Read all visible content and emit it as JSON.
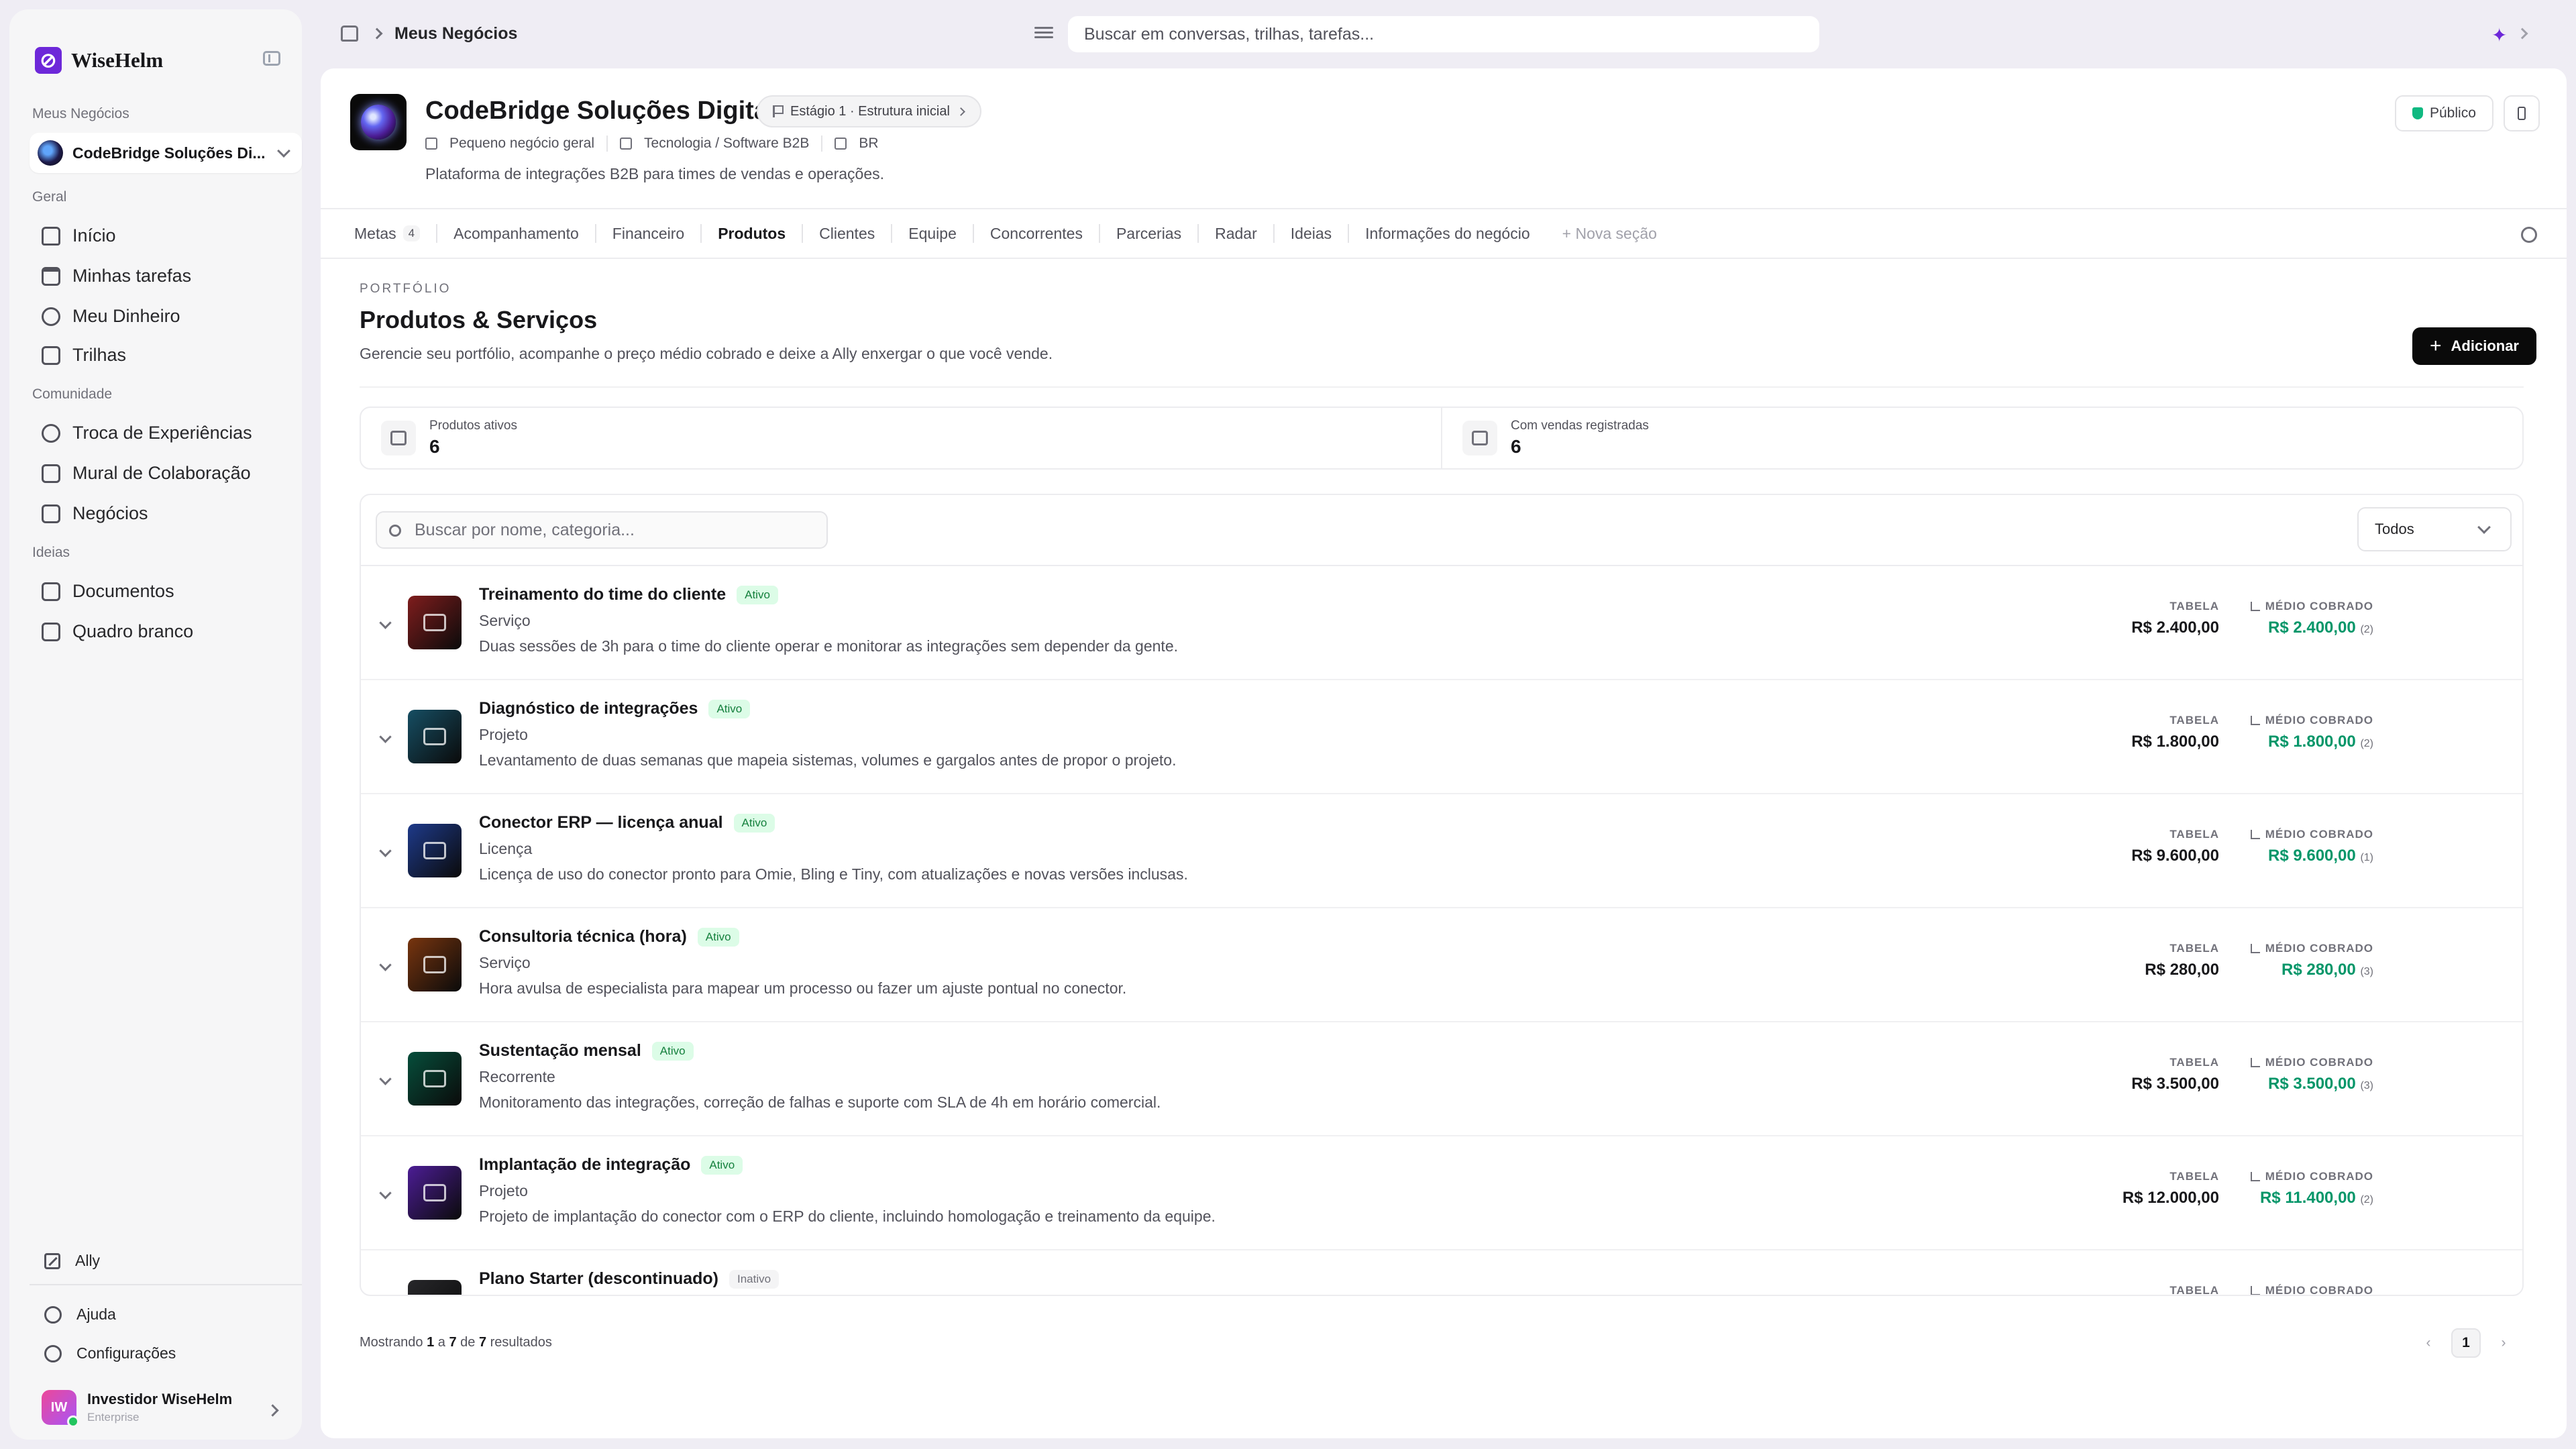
{
  "sidebar": {
    "brand": "WiseHelm",
    "sections": {
      "businesses": "Meus Negócios",
      "general": "Geral",
      "community": "Comunidade",
      "ideas": "Ideias"
    },
    "business_select": "CodeBridge Soluções Di...",
    "general_items": [
      {
        "label": "Início",
        "icon": "home-icon"
      },
      {
        "label": "Minhas tarefas",
        "icon": "calendar-icon"
      },
      {
        "label": "Meu Dinheiro",
        "icon": "piggy-bank-icon"
      },
      {
        "label": "Trilhas",
        "icon": "book-icon"
      }
    ],
    "community_items": [
      {
        "label": "Troca de Experiências",
        "icon": "chat-icon"
      },
      {
        "label": "Mural de Colaboração",
        "icon": "message-icon"
      },
      {
        "label": "Negócios",
        "icon": "building-icon"
      }
    ],
    "idea_items": [
      {
        "label": "Documentos",
        "icon": "document-icon"
      },
      {
        "label": "Quadro branco",
        "icon": "whiteboard-icon"
      }
    ],
    "footer": {
      "ally": "Ally",
      "help": "Ajuda",
      "settings": "Configurações"
    },
    "user": {
      "initials": "IW",
      "name": "Investidor WiseHelm",
      "plan": "Enterprise"
    }
  },
  "topbar": {
    "breadcrumb": "Meus Negócios",
    "search_placeholder": "Buscar em conversas, trilhas, tarefas..."
  },
  "business": {
    "name": "CodeBridge Soluções Digitais",
    "stage": "Estágio 1 · Estrutura inicial",
    "meta": [
      "Pequeno negócio geral",
      "Tecnologia / Software B2B",
      "BR"
    ],
    "description": "Plataforma de integrações B2B para times de vendas e operações.",
    "visibility": "Público"
  },
  "tabs": [
    {
      "label": "Metas",
      "badge": "4"
    },
    {
      "label": "Acompanhamento"
    },
    {
      "label": "Financeiro"
    },
    {
      "label": "Produtos",
      "active": true
    },
    {
      "label": "Clientes"
    },
    {
      "label": "Equipe"
    },
    {
      "label": "Concorrentes"
    },
    {
      "label": "Parcerias"
    },
    {
      "label": "Radar"
    },
    {
      "label": "Ideias"
    },
    {
      "label": "Informações do negócio"
    }
  ],
  "new_section": "+ Nova seção",
  "portfolio": {
    "eyebrow": "PORTFÓLIO",
    "title": "Produtos & Serviços",
    "description": "Gerencie seu portfólio, acompanhe o preço médio cobrado e deixe a Ally enxergar o que você vende.",
    "add_label": "Adicionar"
  },
  "stats": [
    {
      "label": "Produtos ativos",
      "value": "6"
    },
    {
      "label": "Com vendas registradas",
      "value": "6"
    }
  ],
  "list": {
    "search_placeholder": "Buscar por nome, categoria...",
    "filter": "Todos",
    "price_label": "TABELA",
    "avg_label": "MÉDIO COBRADO",
    "products": [
      {
        "name": "Treinamento do time do cliente",
        "status": "Ativo",
        "category": "Serviço",
        "desc": "Duas sessões de 3h para o time do cliente operar e monitorar as integrações sem depender da gente.",
        "price": "R$ 2.400,00",
        "avg": "R$ 2.400,00",
        "count": "(2)",
        "color": "#7f1d1d"
      },
      {
        "name": "Diagnóstico de integrações",
        "status": "Ativo",
        "category": "Projeto",
        "desc": "Levantamento de duas semanas que mapeia sistemas, volumes e gargalos antes de propor o projeto.",
        "price": "R$ 1.800,00",
        "avg": "R$ 1.800,00",
        "count": "(2)",
        "color": "#164e63"
      },
      {
        "name": "Conector ERP — licença anual",
        "status": "Ativo",
        "category": "Licença",
        "desc": "Licença de uso do conector pronto para Omie, Bling e Tiny, com atualizações e novas versões inclusas.",
        "price": "R$ 9.600,00",
        "avg": "R$ 9.600,00",
        "count": "(1)",
        "color": "#1e3a8a"
      },
      {
        "name": "Consultoria técnica (hora)",
        "status": "Ativo",
        "category": "Serviço",
        "desc": "Hora avulsa de especialista para mapear um processo ou fazer um ajuste pontual no conector.",
        "price": "R$ 280,00",
        "avg": "R$ 280,00",
        "count": "(3)",
        "color": "#78350f"
      },
      {
        "name": "Sustentação mensal",
        "status": "Ativo",
        "category": "Recorrente",
        "desc": "Monitoramento das integrações, correção de falhas e suporte com SLA de 4h em horário comercial.",
        "price": "R$ 3.500,00",
        "avg": "R$ 3.500,00",
        "count": "(3)",
        "color": "#064e3b"
      },
      {
        "name": "Implantação de integração",
        "status": "Ativo",
        "category": "Projeto",
        "desc": "Projeto de implantação do conector com o ERP do cliente, incluindo homologação e treinamento da equipe.",
        "price": "R$ 12.000,00",
        "avg": "R$ 11.400,00",
        "count": "(2)",
        "color": "#4c1d95"
      },
      {
        "name": "Plano Starter (descontinuado)",
        "status": "Inativo",
        "category": "",
        "desc": "",
        "price": "",
        "avg": "",
        "count": "",
        "color": "#27272a"
      }
    ]
  },
  "footer": {
    "prefix": "Mostrando",
    "from": "1",
    "mid1": "a",
    "to": "7",
    "mid2": "de",
    "total": "7",
    "suffix": "resultados",
    "page": "1"
  }
}
